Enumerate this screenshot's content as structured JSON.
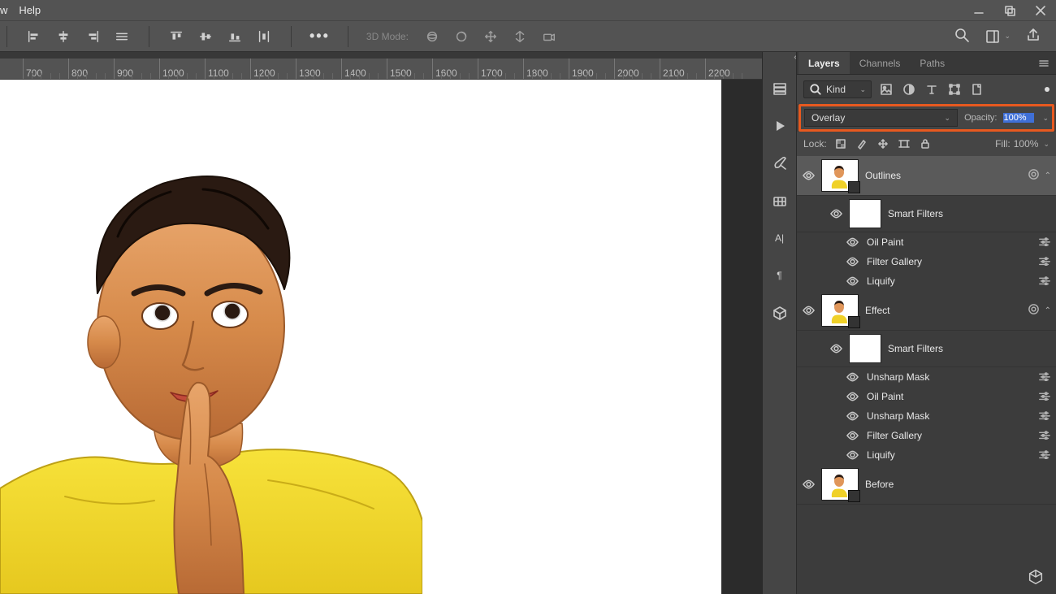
{
  "menubar": {
    "items": [
      "w",
      "Help"
    ]
  },
  "window_controls": {
    "min": "minimize-icon",
    "max": "maximize-icon",
    "close": "close-icon"
  },
  "optbar": {
    "align": [
      "align-left",
      "align-hcenter",
      "align-right",
      "align-justify"
    ],
    "distribute": [
      "dist-top",
      "dist-vcenter",
      "dist-bottom",
      "dist-space"
    ],
    "more": "•••",
    "mode_label": "3D Mode:",
    "mode_icons": [
      "orbit",
      "roll",
      "pan",
      "slide",
      "walk",
      "camera"
    ]
  },
  "ruler": {
    "ticks": [
      "700",
      "800",
      "900",
      "1000",
      "1100",
      "1200",
      "1300",
      "1400",
      "1500",
      "1600",
      "1700",
      "1800",
      "1900",
      "2000",
      "2100",
      "2200"
    ],
    "start": 28,
    "step": 56
  },
  "side_tools": [
    "history-icon",
    "play-icon",
    "brush-settings-icon",
    "color-swatches-icon",
    "character-icon",
    "paragraph-icon",
    "3d-panel-icon"
  ],
  "panel_tabs": {
    "tabs": [
      "Layers",
      "Channels",
      "Paths"
    ],
    "active": 0
  },
  "filter_row": {
    "kind_label": "Kind",
    "types": [
      "image",
      "adjustment",
      "type",
      "shape",
      "smartobject"
    ]
  },
  "blend": {
    "mode": "Overlay",
    "opacity_label": "Opacity:",
    "opacity_value": "100%"
  },
  "lock": {
    "label": "Lock:",
    "icons": [
      "transparency",
      "pixels",
      "position",
      "artboard",
      "all"
    ],
    "fill_label": "Fill:",
    "fill_value": "100%"
  },
  "layers": [
    {
      "name": "Outlines",
      "smart": true,
      "selected": true,
      "has_fx": true
    },
    {
      "name": "Smart Filters",
      "indent": 1,
      "mask": true
    },
    {
      "name": "Oil Paint",
      "indent": 2,
      "adj": true
    },
    {
      "name": "Filter Gallery",
      "indent": 2,
      "adj": true
    },
    {
      "name": "Liquify",
      "indent": 2,
      "adj": true
    },
    {
      "name": "Effect",
      "smart": true,
      "has_fx": true
    },
    {
      "name": "Smart Filters",
      "indent": 1,
      "mask": true
    },
    {
      "name": "Unsharp Mask",
      "indent": 2,
      "adj": true
    },
    {
      "name": "Oil Paint",
      "indent": 2,
      "adj": true
    },
    {
      "name": "Unsharp Mask",
      "indent": 2,
      "adj": true
    },
    {
      "name": "Filter Gallery",
      "indent": 2,
      "adj": true
    },
    {
      "name": "Liquify",
      "indent": 2,
      "adj": true
    },
    {
      "name": "Before",
      "smart": true
    }
  ],
  "character_glyph": "A|",
  "paragraph_glyph": "¶"
}
